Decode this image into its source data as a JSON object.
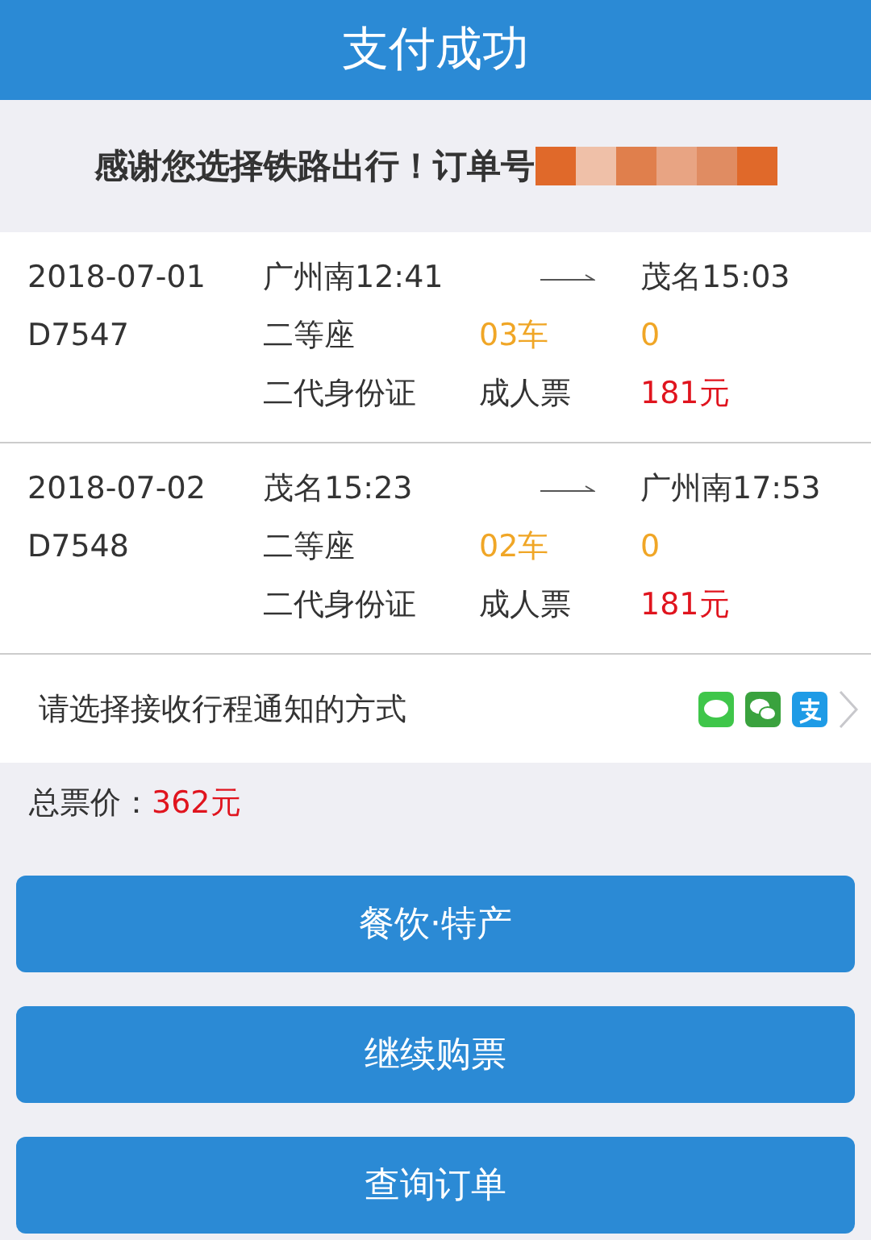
{
  "header": {
    "title": "支付成功"
  },
  "thanks": {
    "text": "感谢您选择铁路出行！订单号"
  },
  "trips": [
    {
      "date": "2018-07-01",
      "train": "D7547",
      "from": "广州南12:41",
      "to": "茂名15:03",
      "seat_class": "二等座",
      "car": "03车",
      "seat": "0",
      "id_type": "二代身份证",
      "ticket_type": "成人票",
      "price": "181元"
    },
    {
      "date": "2018-07-02",
      "train": "D7548",
      "from": "茂名15:23",
      "to": "广州南17:53",
      "seat_class": "二等座",
      "car": "02车",
      "seat": "0",
      "id_type": "二代身份证",
      "ticket_type": "成人票",
      "price": "181元"
    }
  ],
  "notify": {
    "label": "请选择接收行程通知的方式",
    "channels": [
      {
        "kind": "sms"
      },
      {
        "kind": "wechat"
      },
      {
        "kind": "alipay"
      }
    ]
  },
  "total": {
    "label": "总票价：",
    "amount": "362元"
  },
  "buttons": [
    "餐饮·特产",
    "继续购票",
    "查询订单"
  ]
}
